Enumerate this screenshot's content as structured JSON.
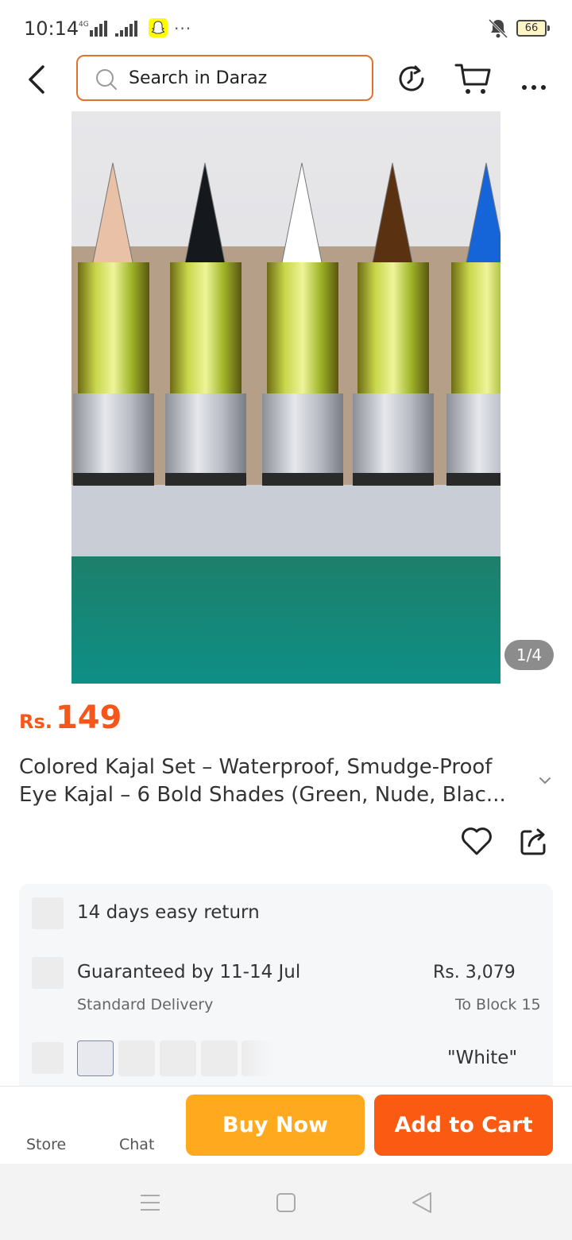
{
  "status_bar": {
    "time": "10:14",
    "battery": "66",
    "icons": [
      "signal-4g-icon",
      "signal-icon",
      "snapchat-icon",
      "more-dots-icon",
      "silent-bell-icon",
      "battery-icon"
    ]
  },
  "header": {
    "search_placeholder": "Search in Daraz",
    "icons": [
      "back-icon",
      "search-icon",
      "history-icon",
      "cart-icon",
      "more-icon"
    ],
    "accent_color": "#E4702D"
  },
  "gallery": {
    "counter": "1/4",
    "kajal_colors": [
      "#e9c1a6",
      "#15181c",
      "#ffffff",
      "#5a3212",
      "#1565d8"
    ]
  },
  "product": {
    "currency": "Rs.",
    "price": "149",
    "title_line1": "Colored Kajal Set – Waterproof, Smudge-Proof",
    "title_line2": "Eye Kajal – 6 Bold Shades (Green, Nude, Blac...",
    "price_color": "#F6561A"
  },
  "info": {
    "return_text": "14 days easy return",
    "delivery_title": "Guaranteed by 11-14 Jul",
    "delivery_type": "Standard Delivery",
    "delivery_price": "Rs. 3,079",
    "delivery_to": "To Block 15",
    "variant_selected": "\"White\""
  },
  "actions": {
    "store_label": "Store",
    "chat_label": "Chat",
    "buy_now": "Buy Now",
    "add_to_cart": "Add to Cart",
    "buy_color": "#FFAA1E",
    "cart_color": "#FA5A12"
  },
  "system_nav": {
    "icons": [
      "menu-icon",
      "home-icon",
      "back-triangle-icon"
    ]
  }
}
